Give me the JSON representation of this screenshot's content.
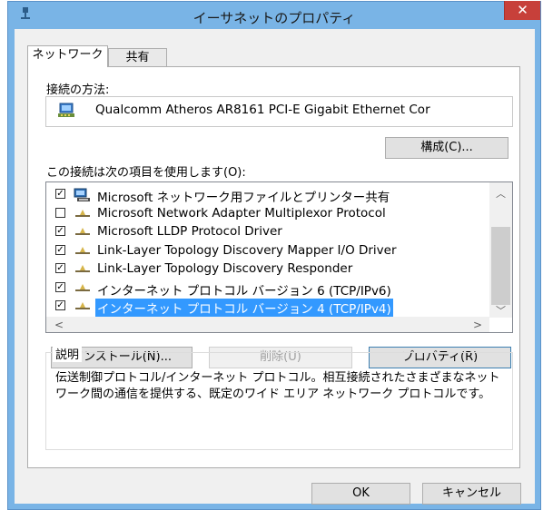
{
  "window": {
    "title": "イーサネットのプロパティ",
    "close_glyph": "✕",
    "accent": "#79b4e6",
    "close_color": "#c7403a"
  },
  "tabs": [
    {
      "label": "ネットワーク",
      "active": true
    },
    {
      "label": "共有",
      "active": false
    }
  ],
  "connection": {
    "label": "接続の方法:",
    "adapter_icon": "network-adapter-icon",
    "adapter_name": "Qualcomm Atheros AR8161 PCI-E Gigabit Ethernet Cor",
    "configure_button": "構成(C)..."
  },
  "items_label": "この接続は次の項目を使用します(O):",
  "items": [
    {
      "checked": true,
      "icon": "network-client-icon",
      "label": "Microsoft ネットワーク用ファイルとプリンター共有",
      "selected": false
    },
    {
      "checked": false,
      "icon": "protocol-icon",
      "label": "Microsoft Network Adapter Multiplexor Protocol",
      "selected": false
    },
    {
      "checked": true,
      "icon": "protocol-icon",
      "label": "Microsoft LLDP Protocol Driver",
      "selected": false
    },
    {
      "checked": true,
      "icon": "protocol-icon",
      "label": "Link-Layer Topology Discovery Mapper I/O Driver",
      "selected": false
    },
    {
      "checked": true,
      "icon": "protocol-icon",
      "label": "Link-Layer Topology Discovery Responder",
      "selected": false
    },
    {
      "checked": true,
      "icon": "protocol-icon",
      "label": "インターネット プロトコル バージョン 6 (TCP/IPv6)",
      "selected": false
    },
    {
      "checked": true,
      "icon": "protocol-icon",
      "label": "インターネット プロトコル バージョン 4 (TCP/IPv4)",
      "selected": true
    }
  ],
  "scroll_arrows": {
    "up": "︿",
    "down": "﹀",
    "left": "<",
    "right": ">"
  },
  "actions": {
    "install": "インストール(N)...",
    "uninstall": "削除(U)",
    "properties": "プロパティ(R)"
  },
  "description": {
    "legend": "説明",
    "text": "伝送制御プロトコル/インターネット プロトコル。相互接続されたさまざまなネットワーク間の通信を提供する、既定のワイド エリア ネットワーク プロトコルです。"
  },
  "footer": {
    "ok": "OK",
    "cancel": "キャンセル"
  },
  "check_glyph": "✓",
  "selection_color": "#3399ff"
}
